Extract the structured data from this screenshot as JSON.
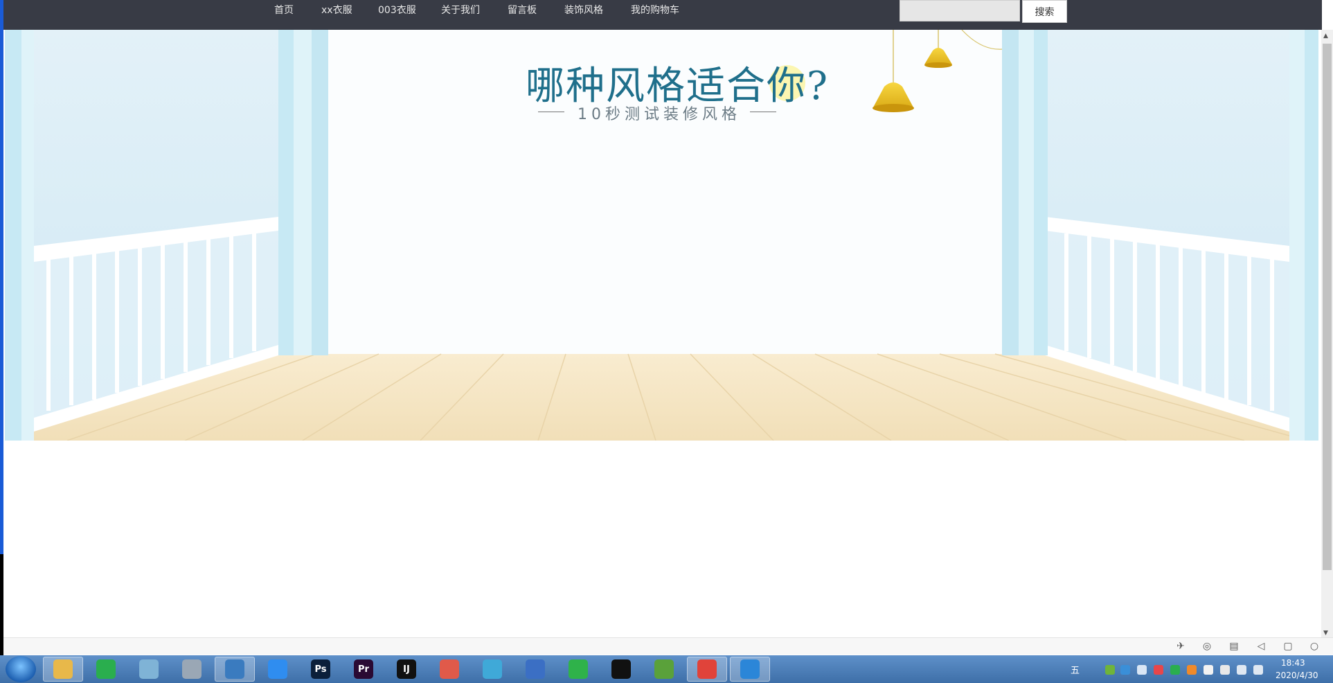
{
  "nav": {
    "items": [
      "首页",
      "xx衣服",
      "003衣服",
      "关于我们",
      "留言板",
      "装饰风格",
      "我的购物车"
    ],
    "search_placeholder": "",
    "search_button": "搜索"
  },
  "banner": {
    "title": "哪种风格适合你?",
    "subtitle": "10秒测试装修风格"
  },
  "taskbar": {
    "apps": [
      {
        "name": "file-explorer",
        "glyph": "",
        "color": "#e8b84a"
      },
      {
        "name": "wechat",
        "glyph": "",
        "color": "#2aae4e"
      },
      {
        "name": "notes",
        "glyph": "",
        "color": "#7fb3d6"
      },
      {
        "name": "calculator",
        "glyph": "",
        "color": "#9aa7b5"
      },
      {
        "name": "mysql-workbench",
        "glyph": "",
        "color": "#3a7bbf"
      },
      {
        "name": "baidu-netdisk",
        "glyph": "",
        "color": "#2f8df0"
      },
      {
        "name": "photoshop",
        "glyph": "Ps",
        "color": "#0b1f3a"
      },
      {
        "name": "premiere",
        "glyph": "Pr",
        "color": "#2a0a33"
      },
      {
        "name": "intellij-idea",
        "glyph": "IJ",
        "color": "#111"
      },
      {
        "name": "draw-tool",
        "glyph": "",
        "color": "#e05a4a"
      },
      {
        "name": "pinwheel-app",
        "glyph": "",
        "color": "#3fa9d8"
      },
      {
        "name": "network-tool",
        "glyph": "",
        "color": "#3b6fc4"
      },
      {
        "name": "thunder",
        "glyph": "",
        "color": "#2fb24a"
      },
      {
        "name": "qq",
        "glyph": "",
        "color": "#111"
      },
      {
        "name": "spring-tool",
        "glyph": "",
        "color": "#5aa13a"
      },
      {
        "name": "chrome-browser",
        "glyph": "",
        "color": "#e0433a"
      },
      {
        "name": "vs-code",
        "glyph": "",
        "color": "#2b86d8"
      }
    ],
    "ime": "五",
    "time": "18:43",
    "date": "2020/4/30"
  },
  "colors": {
    "nav_bg": "#383b45",
    "taskbar": "#4a7db8",
    "title": "#1f6f8b",
    "floor": "#f6e6c4"
  }
}
